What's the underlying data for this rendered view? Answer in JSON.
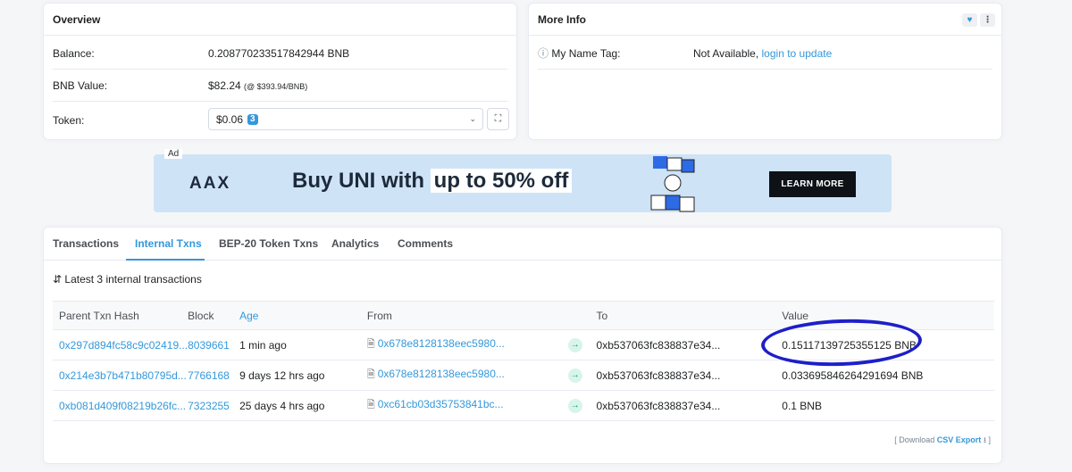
{
  "overview": {
    "title": "Overview",
    "balance_label": "Balance:",
    "balance_value": "0.208770233517842944 BNB",
    "bnb_value_label": "BNB Value:",
    "bnb_value": "$82.24",
    "bnb_rate": "(@ $393.94/BNB)",
    "token_label": "Token:",
    "token_value": "$0.06",
    "token_count": "3"
  },
  "more_info": {
    "title": "More Info",
    "name_tag_label": "My Name Tag:",
    "name_tag_value": "Not Available,",
    "name_tag_link": "login to update"
  },
  "ad": {
    "label": "Ad",
    "logo": "AAX",
    "text_plain": "Buy UNI with",
    "text_highlight": "up to 50% off",
    "cta": "LEARN MORE"
  },
  "tabs": [
    "Transactions",
    "Internal Txns",
    "BEP-20 Token Txns",
    "Analytics",
    "Comments"
  ],
  "summary": "Latest 3 internal transactions",
  "table": {
    "headers": [
      "Parent Txn Hash",
      "Block",
      "Age",
      "From",
      "",
      "To",
      "Value"
    ],
    "rows": [
      {
        "hash": "0x297d894fc58c9c02419...",
        "block": "8039661",
        "age": "1 min ago",
        "from": "0x678e8128138eec5980...",
        "to": "0xb537063fc838837e34...",
        "value": "0.15117139725355125 BNB"
      },
      {
        "hash": "0x214e3b7b471b80795d...",
        "block": "7766168",
        "age": "9 days 12 hrs ago",
        "from": "0x678e8128138eec5980...",
        "to": "0xb537063fc838837e34...",
        "value": "0.033695846264291694 BNB"
      },
      {
        "hash": "0xb081d409f08219b26fc...",
        "block": "7323255",
        "age": "25 days 4 hrs ago",
        "from": "0xc61cb03d35753841bc...",
        "to": "0xb537063fc838837e34...",
        "value": "0.1 BNB"
      }
    ]
  },
  "export": {
    "prefix": "[ Download",
    "link": "CSV Export",
    "suffix": "]"
  },
  "colors": {
    "link": "#3498db",
    "annotation": "#1d1fc9"
  }
}
